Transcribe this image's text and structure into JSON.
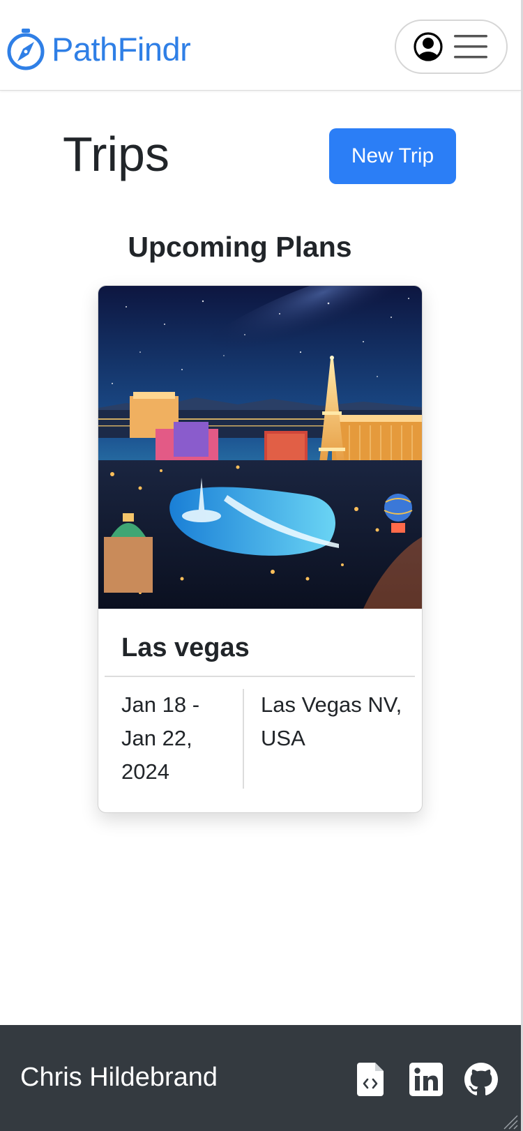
{
  "navbar": {
    "brand_label": "PathFindr",
    "brand_icon": "compass-icon",
    "profile_icon": "user-circle-icon",
    "menu_icon": "hamburger-menu-icon"
  },
  "header": {
    "title": "Trips",
    "new_trip_label": "New Trip"
  },
  "upcoming": {
    "heading": "Upcoming Plans",
    "trips": [
      {
        "name": "Las vegas",
        "dates": "Jan 18 - Jan 22, 2024",
        "location": "Las Vegas NV, USA"
      }
    ]
  },
  "footer": {
    "author": "Chris Hildebrand",
    "links": [
      {
        "icon": "code-file-icon"
      },
      {
        "icon": "linkedin-icon"
      },
      {
        "icon": "github-icon"
      }
    ]
  },
  "colors": {
    "brand": "#2f7fe6",
    "primary_button": "#2b7ef6",
    "footer_bg": "#343a40",
    "text": "#212529"
  }
}
